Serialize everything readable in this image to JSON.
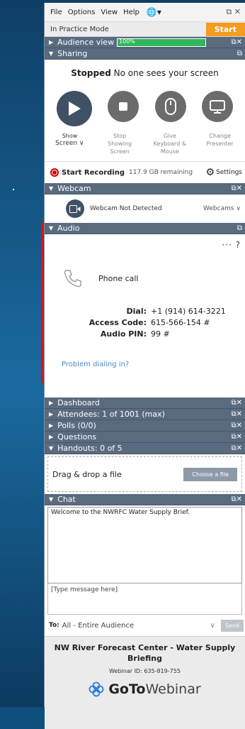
{
  "menu": {
    "file": "File",
    "options": "Options",
    "view": "View",
    "help": "Help",
    "win_controls": "⧉ ✕"
  },
  "practice": {
    "label": "In Practice Mode",
    "start": "Start"
  },
  "sections": {
    "audience_view": "Audience view",
    "audience_meter": "100%",
    "sharing": "Sharing",
    "webcam": "Webcam",
    "audio": "Audio",
    "dashboard": "Dashboard",
    "attendees": "Attendees: 1 of 1001 (max)",
    "polls": "Polls (0/0)",
    "questions": "Questions",
    "handouts": "Handouts: 0 of 5",
    "chat": "Chat"
  },
  "sharing": {
    "status_bold": "Stopped",
    "status_rest": "No one sees your screen",
    "show_screen_1": "Show",
    "show_screen_2": "Screen ∨",
    "stop_showing_1": "Stop",
    "stop_showing_2": "Showing",
    "stop_showing_3": "Screen",
    "give_keyboard_1": "Give",
    "give_keyboard_2": "Keyboard &",
    "give_keyboard_3": "Mouse",
    "change_presenter_1": "Change",
    "change_presenter_2": "Presenter"
  },
  "recording": {
    "label": "Start Recording",
    "remaining": "117.9 GB remaining",
    "settings": "Settings"
  },
  "webcam": {
    "status": "Webcam Not Detected",
    "dropdown": "Webcams ∨"
  },
  "audio": {
    "menu": "··· ?",
    "mode": "Phone call",
    "dial_label": "Dial:",
    "dial_value": "+1 (914) 614-3221",
    "access_label": "Access Code:",
    "access_value": "615-566-154 #",
    "pin_label": "Audio PIN:",
    "pin_value": "99 #",
    "problem": "Problem dialing in?"
  },
  "handouts": {
    "drop": "Drag & drop a file",
    "choose": "Choose a file"
  },
  "chat": {
    "welcome": "Welcome to the NWRFC Water Supply Brief.",
    "placeholder": "[Type message here]",
    "to_label": "To:",
    "to_value": "All - Entire Audience",
    "send": "Send"
  },
  "footer": {
    "title_1": "NW River Forecast Center - Water Supply",
    "title_2": "Briefing",
    "webinar_id": "Webinar ID: 635-819-755",
    "brand_bold": "GoTo",
    "brand_rest": "Webinar"
  }
}
